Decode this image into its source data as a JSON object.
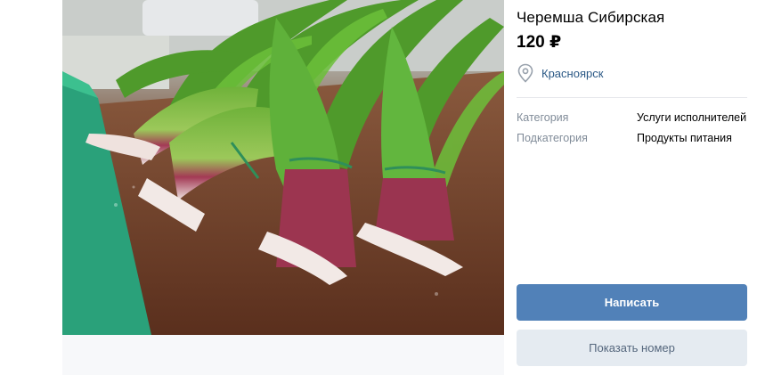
{
  "product": {
    "title": "Черемша Сибирская",
    "price": "120 ₽",
    "location": "Красноярск"
  },
  "properties": [
    {
      "label": "Категория",
      "value": "Услуги исполнителей"
    },
    {
      "label": "Подкатегория",
      "value": "Продукты питания"
    }
  ],
  "actions": {
    "write_label": "Написать",
    "show_number_label": "Показать номер"
  },
  "colors": {
    "accent": "#5181b8",
    "secondary_button_bg": "#e5ebf1",
    "link": "#2a5885",
    "muted_label": "#818c99"
  },
  "icons": {
    "location": "location-pin-icon"
  }
}
